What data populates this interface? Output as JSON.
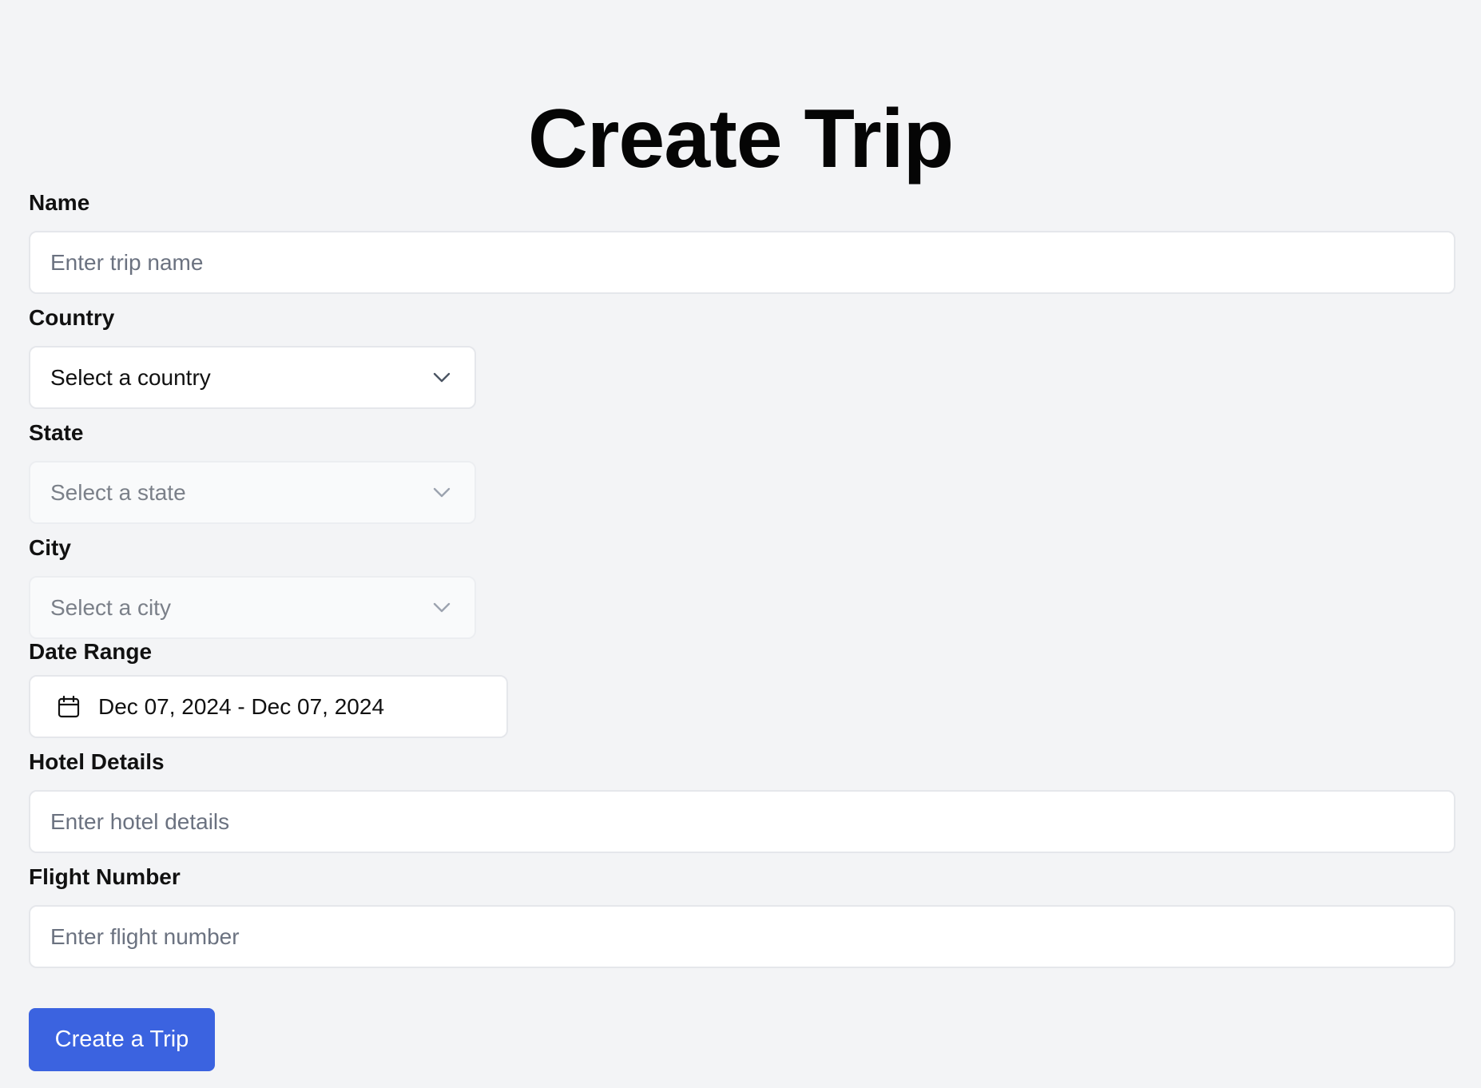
{
  "page": {
    "title": "Create Trip"
  },
  "form": {
    "name": {
      "label": "Name",
      "placeholder": "Enter trip name",
      "value": ""
    },
    "country": {
      "label": "Country",
      "selected": "Select a country",
      "icon": "chevron-down-icon"
    },
    "state": {
      "label": "State",
      "selected": "Select a state",
      "disabled": true,
      "icon": "chevron-down-icon"
    },
    "city": {
      "label": "City",
      "selected": "Select a city",
      "disabled": true,
      "icon": "chevron-down-icon"
    },
    "date_range": {
      "label": "Date Range",
      "value": "Dec 07, 2024 - Dec 07, 2024",
      "icon": "calendar-icon"
    },
    "hotel": {
      "label": "Hotel Details",
      "placeholder": "Enter hotel details",
      "value": ""
    },
    "flight": {
      "label": "Flight Number",
      "placeholder": "Enter flight number",
      "value": ""
    },
    "submit_label": "Create a Trip"
  },
  "colors": {
    "background": "#f3f4f6",
    "primary_button": "#3b63e0",
    "field_border": "#e5e7eb",
    "placeholder": "#6b7280"
  }
}
